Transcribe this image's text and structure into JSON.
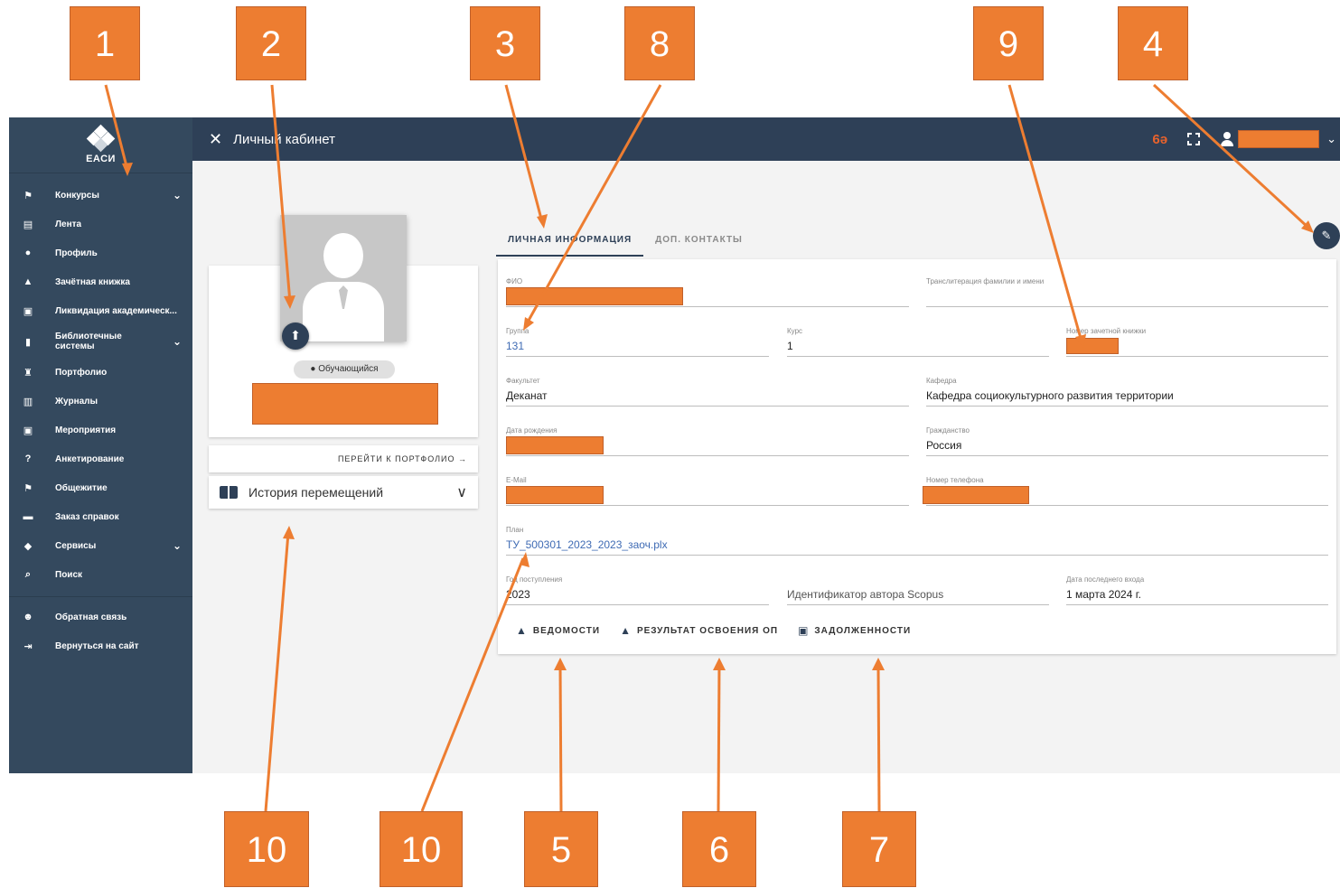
{
  "sidebar": {
    "logo_text": "ЕАСИ",
    "items": [
      {
        "label": "Конкурсы",
        "icon": "flag-checkered-icon"
      },
      {
        "label": "Лента",
        "icon": "newspaper-icon"
      },
      {
        "label": "Профиль",
        "icon": "user-icon"
      },
      {
        "label": "Зачётная книжка",
        "icon": "graduation-cap-icon"
      },
      {
        "label": "Ликвидация академическ...",
        "icon": "calendar-icon"
      },
      {
        "label": "Библиотечные системы",
        "icon": "book-icon"
      },
      {
        "label": "Портфолио",
        "icon": "trophy-icon"
      },
      {
        "label": "Журналы",
        "icon": "book-open-icon"
      },
      {
        "label": "Мероприятия",
        "icon": "calendar-icon"
      },
      {
        "label": "Анкетирование",
        "icon": "question-circle-icon"
      },
      {
        "label": "Общежитие",
        "icon": "flag-checkered-icon"
      },
      {
        "label": "Заказ справок",
        "icon": "file-icon"
      },
      {
        "label": "Сервисы",
        "icon": "layers-icon"
      },
      {
        "label": "Поиск",
        "icon": "search-icon"
      },
      {
        "label": "Обратная связь",
        "icon": "users-icon"
      },
      {
        "label": "Вернуться на сайт",
        "icon": "sign-out-icon"
      }
    ]
  },
  "topbar": {
    "title": "Личный кабинет",
    "close_icon": "✕",
    "glasses_icon": "ᨓ",
    "chevron": "⌄"
  },
  "profile": {
    "role": "Обучающийся",
    "portfolio_link": "ПЕРЕЙТИ К ПОРТФОЛИО →",
    "history_label": "История перемещений"
  },
  "tabs": [
    "ЛИЧНАЯ ИНФОРМАЦИЯ",
    "ДОП. КОНТАКТЫ"
  ],
  "fields": {
    "fio_label": "ФИО",
    "translit_label": "Транслитерация фамилии и имени",
    "group_label": "Группа",
    "group_value": "131",
    "course_label": "Курс",
    "course_value": "1",
    "record_book_label": "Номер зачетной книжки",
    "faculty_label": "Факультет",
    "faculty_value": "Деканат",
    "department_label": "Кафедра",
    "department_value": "Кафедра социокультурного развития территории",
    "birth_label": "Дата рождения",
    "citizenship_label": "Гражданство",
    "citizenship_value": "Россия",
    "email_label": "E-Mail",
    "phone_label": "Номер телефона",
    "plan_label": "План",
    "plan_value": "ТУ_500301_2023_2023_заоч.plx",
    "admission_label": "Год поступления",
    "admission_value": "2023",
    "scopus_placeholder": "Идентификатор автора Scopus",
    "last_login_label": "Дата последнего входа",
    "last_login_value": "1 марта 2024 г."
  },
  "actions": [
    "ВЕДОМОСТИ",
    "РЕЗУЛЬТАТ ОСВОЕНИЯ ОП",
    "ЗАДОЛЖЕННОСТИ"
  ],
  "callouts_top": [
    "1",
    "2",
    "3",
    "8",
    "9",
    "4"
  ],
  "callouts_bottom": [
    "10",
    "10",
    "5",
    "6",
    "7"
  ],
  "colors": {
    "sidebar": "#34495e",
    "topbar": "#2e4057",
    "callout": "#ed7d31",
    "link": "#3f6bb4",
    "glasses": "#e8622c"
  }
}
